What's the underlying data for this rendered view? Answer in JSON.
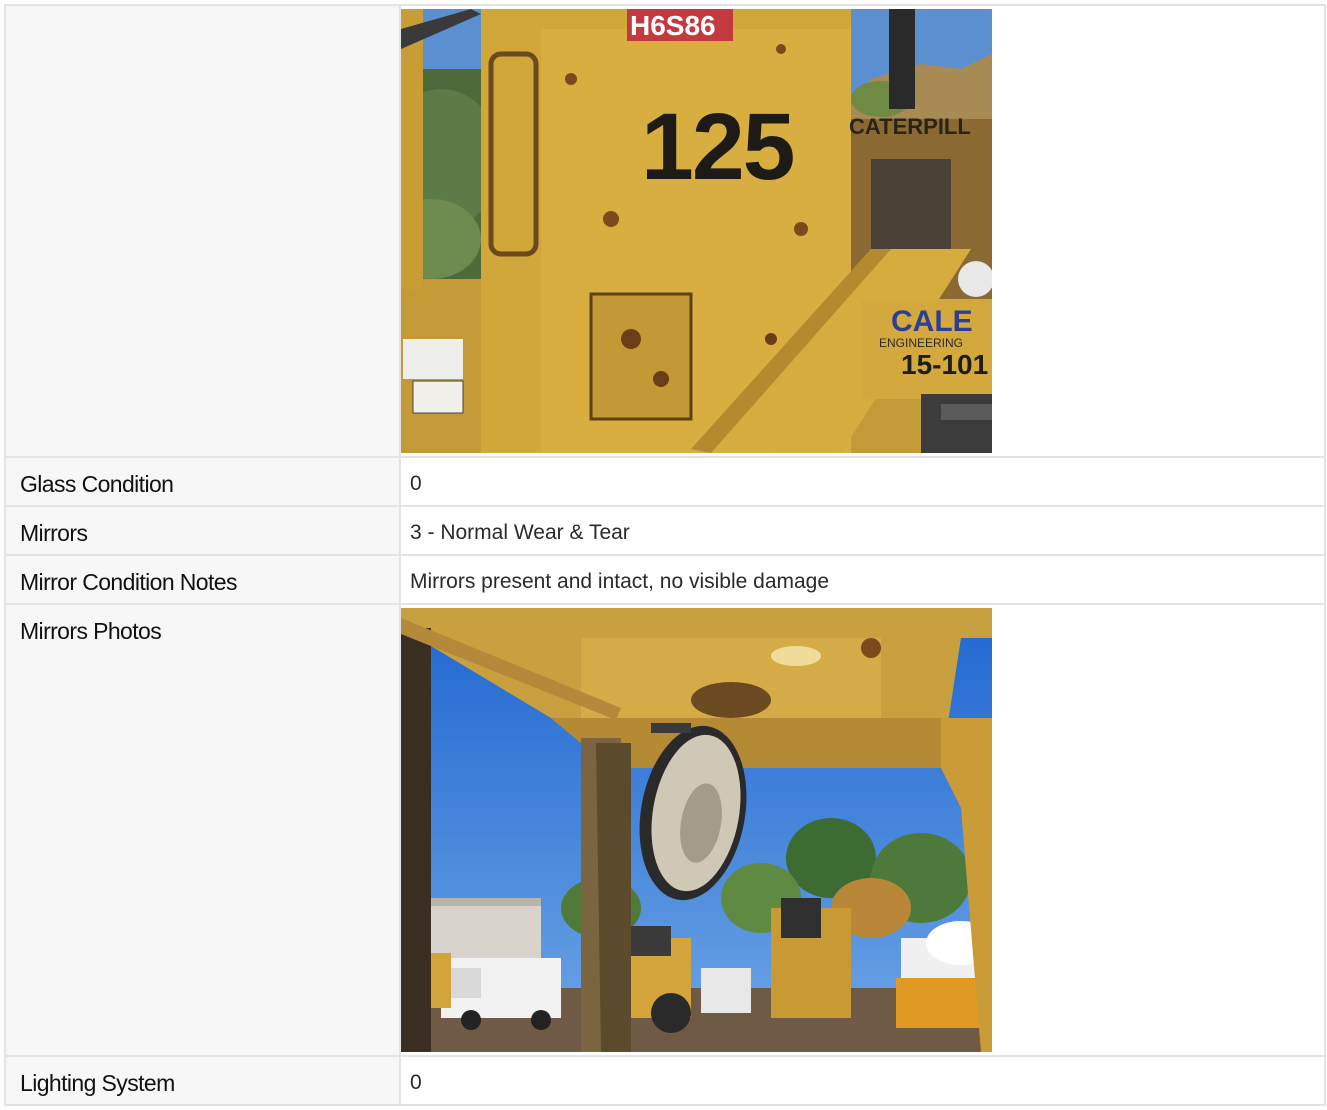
{
  "rows": [
    {
      "label": "",
      "type": "photo",
      "photo": "loader-side-panel-125-photo"
    },
    {
      "label": "Glass Condition",
      "type": "text",
      "value": "0"
    },
    {
      "label": "Mirrors",
      "type": "text",
      "value": "3 - Normal Wear & Tear"
    },
    {
      "label": "Mirror Condition Notes",
      "type": "text",
      "value": "Mirrors present and intact, no visible damage"
    },
    {
      "label": "Mirrors Photos",
      "type": "photo",
      "photo": "cab-mirror-yard-photo"
    },
    {
      "label": "Lighting System",
      "type": "text",
      "value": "0"
    }
  ],
  "photo1": {
    "unit_number": "125",
    "tag_text": "H6S86",
    "brand_text": "CATERPILL",
    "logo_text": "CALE",
    "logo_sub": "ENGINEERING",
    "asset_id": "15-101"
  },
  "colors": {
    "border": "#e4e4e4",
    "label_bg": "#f7f7f7",
    "machine_yellow": "#d4a93a",
    "sky_blue": "#2e78d8"
  }
}
